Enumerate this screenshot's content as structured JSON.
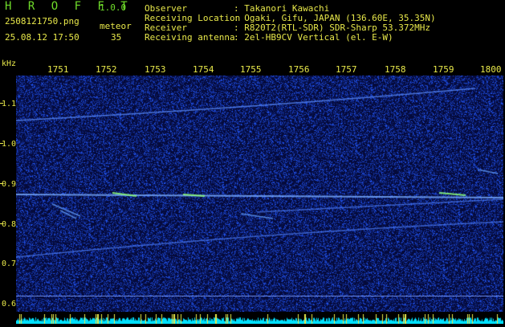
{
  "app": {
    "name": "H R O F F T",
    "version": "1.0.0"
  },
  "file": {
    "name": "2508121750.png",
    "datetime": "25.08.12 17:50"
  },
  "meteor": {
    "label": "meteor",
    "count": "35"
  },
  "info": [
    {
      "key": "Observer",
      "value": ": Takanori Kawachi"
    },
    {
      "key": "Receiving Location",
      "value": ": Ogaki, Gifu, JAPAN (136.60E, 35.35N)"
    },
    {
      "key": "Receiver",
      "value": ": R820T2(RTL-SDR) SDR-Sharp 53.372MHz"
    },
    {
      "key": "Receiving antenna",
      "value": ": 2el-HB9CV Vertical (el. E-W)"
    }
  ],
  "y_axis": {
    "unit": "kHz",
    "ticks": [
      "1.1",
      "1.0",
      "0.9",
      "0.8",
      "0.7",
      "0.6"
    ]
  },
  "x_axis": {
    "ticks": [
      "1751",
      "1752",
      "1753",
      "1754",
      "1755",
      "1756",
      "1757",
      "1758",
      "1759",
      "1800"
    ]
  },
  "colors": {
    "background": "#000a3a",
    "noise": "#1a3fd6",
    "trace": "#4a7cff",
    "echo": "#8dfc7a",
    "text_green": "#6fdc2a",
    "text_yellow": "#e8e84a",
    "histogram": "#00e0ff",
    "histogram_peak": "#e8e84a"
  }
}
